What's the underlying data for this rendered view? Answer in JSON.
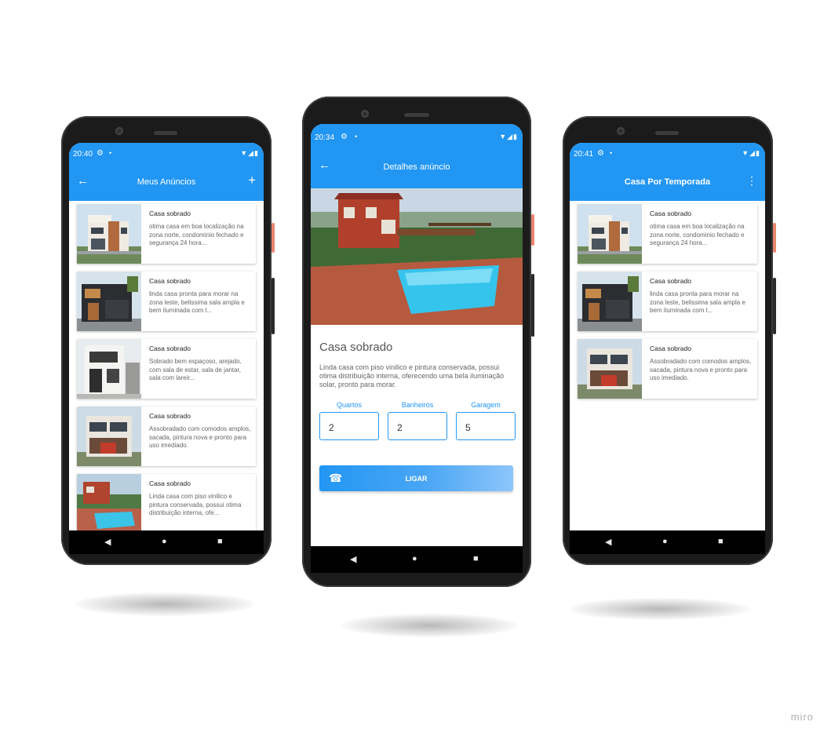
{
  "status_bar": [
    {
      "time": "20:40",
      "gear_icon": "⚙",
      "dot": "•",
      "system_icons": "▼◢▮"
    },
    {
      "time": "20:34",
      "gear_icon": "⚙",
      "dot": "•",
      "system_icons": "▼◢▮"
    },
    {
      "time": "20:41",
      "gear_icon": "⚙",
      "dot": "•",
      "system_icons": "▼◢▮"
    }
  ],
  "icons": {
    "back": "←",
    "add": "+",
    "menu": "⋮",
    "phone": "☎",
    "nav_back": "◀",
    "nav_home": "●",
    "nav_recent": "■"
  },
  "colors": {
    "primary": "#2196f3",
    "nav": "#000000"
  },
  "left_screen": {
    "title": "Meus Anúncios",
    "cards": [
      {
        "title": "Casa sobrado",
        "desc": "otima casa em boa localização na zona norte, condominio fechado e segurança 24 hora..."
      },
      {
        "title": "Casa sobrado",
        "desc": "linda casa pronta para morar na zona leste, belissima sala ampla e bem iluminada com l..."
      },
      {
        "title": "Casa sobrado",
        "desc": "Sobrado bem espaçoso, arejado, com sala de estar, sala de jantar, sala com lareir..."
      },
      {
        "title": "Casa sobrado",
        "desc": "Assobradado com comodos amplos, sacada, pintura nova e pronto para uso imediado."
      },
      {
        "title": "Casa sobrado",
        "desc": "Linda casa com piso vinilico e pintura conservada, possui otima distribuição interna, ofe..."
      }
    ]
  },
  "middle_screen": {
    "title": "Detalhes  anúncio",
    "heading": "Casa sobrado",
    "description": "Linda casa com piso vinilico e pintura conservada, possui otima distribuição interna, oferecendo uma bela iluminação solar, pronto para morar.",
    "fields": [
      {
        "label": "Quartos",
        "value": "2"
      },
      {
        "label": "Banheiros",
        "value": "2"
      },
      {
        "label": "Garagem",
        "value": "5"
      }
    ],
    "call_button": "LIGAR"
  },
  "right_screen": {
    "title": "Casa Por Temporada",
    "cards": [
      {
        "title": "Casa sobrado",
        "desc": "otima casa em boa localização na zona norte, condominio fechado e segurança 24 hora..."
      },
      {
        "title": "Casa sobrado",
        "desc": "linda casa pronta para morar na zona leste, belissima sala ampla e bem iluminada com l..."
      },
      {
        "title": "Casa sobrado",
        "desc": "Assobradado com comodos amplos, sacada, pintura nova e pronto para uso imediado."
      }
    ]
  },
  "watermark": "miro"
}
